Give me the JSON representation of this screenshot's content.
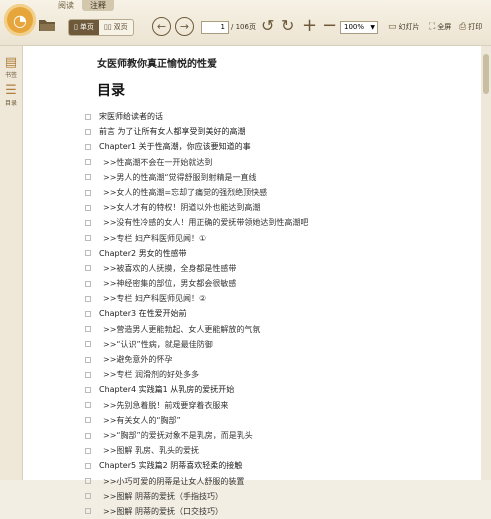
{
  "toolbar": {
    "tabs": [
      "阅读",
      "注释"
    ],
    "view_single": "单页",
    "view_double": "双页",
    "page_current": "1",
    "page_total": "/ 106页",
    "zoom": "100%",
    "slideshow": "幻灯片",
    "fullscreen": "全屏",
    "print": "打印"
  },
  "sidebar": {
    "bookmark": "书签",
    "toc": "目录"
  },
  "document": {
    "title": "女医师教你真正愉悦的性爱",
    "toc_heading": "目录",
    "entries": [
      {
        "text": "宋医师给读者的话",
        "level": 0
      },
      {
        "text": "前言  为了让所有女人都享受到美好的高潮",
        "level": 0
      },
      {
        "text": "Chapter1 关于性高潮，你应该要知道的事",
        "level": 0
      },
      {
        "text": ">>性高潮不会在一开始就达到",
        "level": 1
      },
      {
        "text": ">>男人的性高潮“觉得舒服到射精是一直线",
        "level": 1
      },
      {
        "text": ">>女人的性高潮=忘却了痛觉的强烈绝顶快感",
        "level": 1
      },
      {
        "text": ">>女人才有的特权！阴道以外也能达到高潮",
        "level": 1
      },
      {
        "text": ">>没有性冷感的女人！用正确的爱抚带领她达到性高潮吧",
        "level": 1
      },
      {
        "text": ">>专栏  妇产科医师见闻！①",
        "level": 1
      },
      {
        "text": "Chapter2 男女的性感带",
        "level": 0
      },
      {
        "text": ">>被喜欢的人抚摸，全身都是性感带",
        "level": 1
      },
      {
        "text": ">>神经密集的部位，男女都会很敏感",
        "level": 1
      },
      {
        "text": ">>专栏  妇产科医师见闻！②",
        "level": 1
      },
      {
        "text": "Chapter3 在性爱开始前",
        "level": 0
      },
      {
        "text": ">>营造男人更能勃起、女人更能解放的气氛",
        "level": 1
      },
      {
        "text": ">>“认识”性病，就是最佳防御",
        "level": 1
      },
      {
        "text": ">>避免意外的怀孕",
        "level": 1
      },
      {
        "text": ">>专栏  润滑剂的好处多多",
        "level": 1
      },
      {
        "text": "Chapter4 实践篇1 从乳房的爱抚开始",
        "level": 0
      },
      {
        "text": ">>先别急着脱！前戏要穿着衣服来",
        "level": 1
      },
      {
        "text": ">>有关女人的“胸部”",
        "level": 1
      },
      {
        "text": ">>“胸部”的爱抚对象不是乳房，而是乳头",
        "level": 1
      },
      {
        "text": ">>图解  乳房、乳头的爱抚",
        "level": 1
      },
      {
        "text": "Chapter5 实践篇2 阴蒂喜欢轻柔的接触",
        "level": 0
      },
      {
        "text": ">>小巧可爱的阴蒂是让女人舒服的装置",
        "level": 1
      },
      {
        "text": ">>图解  阴蒂的爱抚（手指技巧）",
        "level": 1
      },
      {
        "text": ">>图解  阴蒂的爱抚（口交技巧）",
        "level": 1
      }
    ]
  }
}
